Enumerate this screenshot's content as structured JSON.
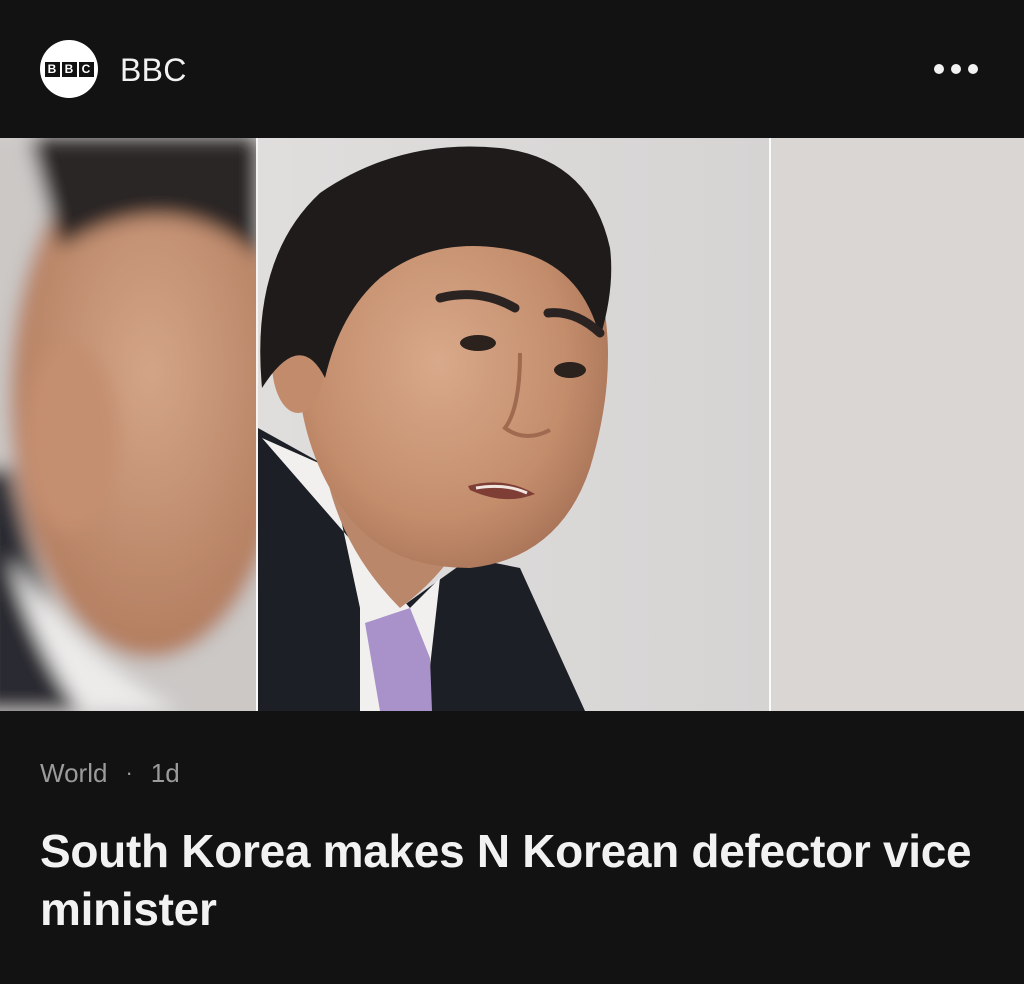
{
  "publisher": {
    "name": "BBC",
    "logo_letters": [
      "B",
      "B",
      "C"
    ]
  },
  "menu": {
    "icon": "more-horizontal-icon"
  },
  "hero_image": {
    "subject": "portrait-photo"
  },
  "article": {
    "category": "World",
    "separator": "·",
    "age": "1d",
    "headline": "South Korea makes N Korean defector vice minister"
  },
  "colors": {
    "background": "#121212",
    "text_primary": "#f2f2f2",
    "text_secondary": "#9b9b9b"
  }
}
